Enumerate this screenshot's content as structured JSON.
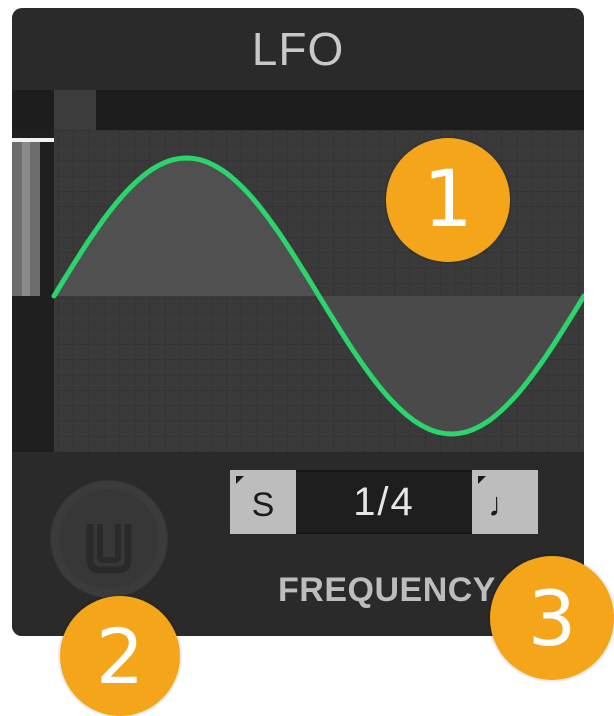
{
  "panel": {
    "title": "LFO",
    "rate": {
      "sync_mode_label": "S",
      "value": "1/4",
      "note_mode_glyph": "♩"
    },
    "frequency_label": "FREQUENCY"
  },
  "waveform": {
    "shape": "sine",
    "stroke_color": "#2bd46d",
    "fill_color": "#4e4e4e"
  },
  "callouts": [
    "1",
    "2",
    "3"
  ],
  "colors": {
    "panel_bg": "#2a2a2a",
    "callout": "#f5a51a",
    "wave": "#2bd46d"
  },
  "icons": {
    "knob": "amount-knob-icon",
    "sync": "sync-seconds-icon",
    "note": "quarter-note-icon"
  }
}
